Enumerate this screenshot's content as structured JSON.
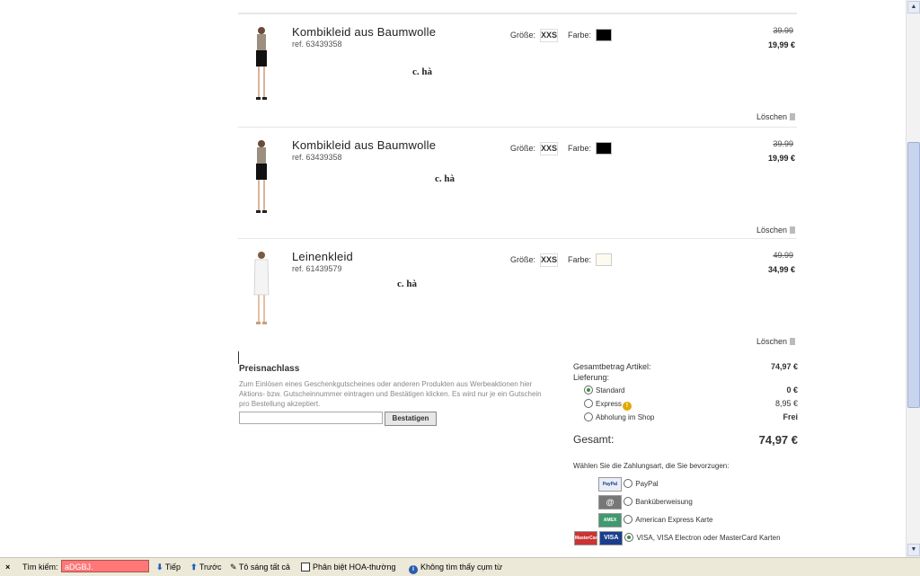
{
  "cart": {
    "items": [
      {
        "name": "Kombikleid aus Baumwolle",
        "ref": "ref. 63439358",
        "size_label": "Größe:",
        "size": "XXS",
        "color_label": "Farbe:",
        "color_hex": "#000000",
        "old_price": "39.99",
        "new_price": "19,99 €",
        "note": "c. hà",
        "delete_label": "Löschen"
      },
      {
        "name": "Kombikleid aus Baumwolle",
        "ref": "ref. 63439358",
        "size_label": "Größe:",
        "size": "XXS",
        "color_label": "Farbe:",
        "color_hex": "#000000",
        "old_price": "39.99",
        "new_price": "19,99 €",
        "note": "c. hà",
        "delete_label": "Löschen"
      },
      {
        "name": "Leinenkleid",
        "ref": "ref. 61439579",
        "size_label": "Größe:",
        "size": "XXS",
        "color_label": "Farbe:",
        "color_hex": "#fdfbf0",
        "old_price": "49.99",
        "new_price": "34,99 €",
        "note": "c. hà",
        "delete_label": "Löschen"
      }
    ]
  },
  "promo": {
    "title": "Preisnachlass",
    "text": "Zum Einlösen eines Geschenkgutscheines oder anderen Produkten aus Werbeaktionen hier Aktions- bzw. Gutscheinnummer eintragen und Bestätigen klicken. Es wird nur je ein Gutschein pro Bestellung akzeptiert.",
    "input_value": "",
    "button": "Bestatigen"
  },
  "summary": {
    "items_label": "Gesamtbetrag Artikel:",
    "items_value": "74,97 €",
    "delivery_label": "Lieferung:",
    "delivery_options": [
      {
        "label": "Standard",
        "value": "0 €",
        "selected": true
      },
      {
        "label": "Express",
        "value": "8,95 €",
        "selected": false
      },
      {
        "label": "Abholung im Shop",
        "value": "Frei",
        "selected": false
      }
    ],
    "total_label": "Gesamt:",
    "total_value": "74,97 €"
  },
  "payment": {
    "title": "Wählen Sie die Zahlungsart, die Sie bevorzugen:",
    "methods": [
      {
        "label": "PayPal",
        "logo": "PayPal",
        "selected": false
      },
      {
        "label": "Banküberweisung",
        "logo": "@",
        "selected": false
      },
      {
        "label": "American Express Karte",
        "logo": "AMEX",
        "selected": false
      },
      {
        "label": "VISA, VISA Electron oder MasterCard Karten",
        "logo": "VISA",
        "logo2": "MasterCard",
        "selected": true
      }
    ]
  },
  "findbar": {
    "search_label": "Tìm kiếm:",
    "search_value": "aDGBJ.",
    "next": "Tiếp",
    "prev": "Trước",
    "highlight": "Tô sáng tất cả",
    "match_case": "Phân biệt HOA-thường",
    "status": "Không tìm thấy cụm từ"
  }
}
